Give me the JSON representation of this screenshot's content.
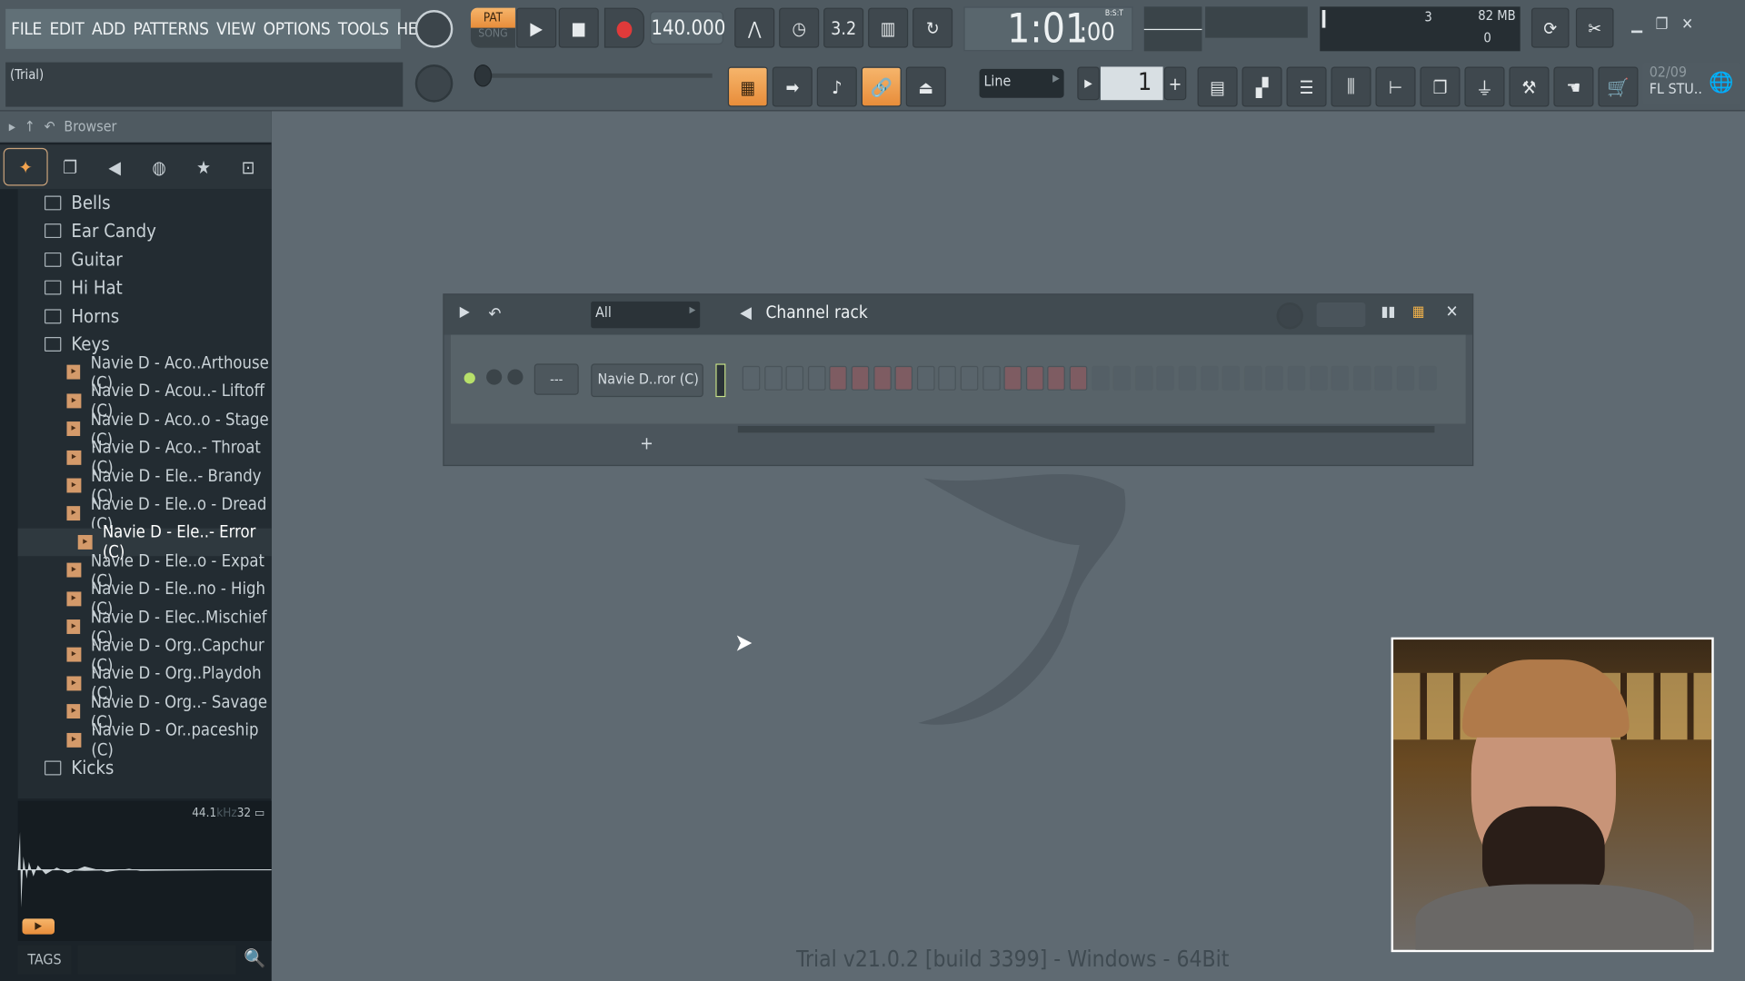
{
  "menu": [
    "FILE",
    "EDIT",
    "ADD",
    "PATTERNS",
    "VIEW",
    "OPTIONS",
    "TOOLS",
    "HELP"
  ],
  "hint": "(Trial)",
  "transport": {
    "pat": "PAT",
    "song": "SONG",
    "tempo": "140.000",
    "time_main": "1:01",
    "time_ticks": ":00",
    "time_format": "B:S:T"
  },
  "cpu": {
    "value": "3",
    "memory": "82 MB",
    "polyphony": "0"
  },
  "toolbar": {
    "snap": "Line",
    "pattern": "1",
    "news_date": "02/09",
    "news_title": "FL STU.."
  },
  "browser": {
    "title": "Browser",
    "items": [
      {
        "type": "folder",
        "label": "Bells"
      },
      {
        "type": "folder",
        "label": "Ear Candy"
      },
      {
        "type": "folder",
        "label": "Guitar"
      },
      {
        "type": "folder",
        "label": "Hi Hat"
      },
      {
        "type": "folder",
        "label": "Horns"
      },
      {
        "type": "folder",
        "label": "Keys",
        "open": true
      },
      {
        "type": "file",
        "label": "Navie D - Aco..Arthouse (C)"
      },
      {
        "type": "file",
        "label": "Navie D - Acou..- Liftoff (C)"
      },
      {
        "type": "file",
        "label": "Navie D - Aco..o - Stage (C)"
      },
      {
        "type": "file",
        "label": "Navie D - Aco..- Throat (C)"
      },
      {
        "type": "file",
        "label": "Navie D - Ele..- Brandy (C)"
      },
      {
        "type": "file",
        "label": "Navie D - Ele..o - Dread (C)"
      },
      {
        "type": "file",
        "label": "Navie D - Ele..- Error (C)",
        "selected": true
      },
      {
        "type": "file",
        "label": "Navie D - Ele..o - Expat (C)"
      },
      {
        "type": "file",
        "label": "Navie D - Ele..no - High (C)"
      },
      {
        "type": "file",
        "label": "Navie D - Elec..Mischief (C)"
      },
      {
        "type": "file",
        "label": "Navie D - Org..Capchur (C)"
      },
      {
        "type": "file",
        "label": "Navie D - Org..Playdoh (C)"
      },
      {
        "type": "file",
        "label": "Navie D - Org..- Savage (C)"
      },
      {
        "type": "file",
        "label": "Navie D - Or..paceship (C)"
      },
      {
        "type": "folder",
        "label": "Kicks"
      }
    ],
    "sample_rate": "44.1",
    "sample_unit": "kHz",
    "bit_depth": "32",
    "tags_label": "TAGS"
  },
  "channel_rack": {
    "title": "Channel rack",
    "filter": "All",
    "channel_name": "Navie D..ror (C)",
    "channel_route": "---",
    "add_label": "+"
  },
  "status": "Trial v21.0.2 [build 3399] - Windows - 64Bit",
  "colors": {
    "accent": "#f0a050",
    "bg": "#5f6a72"
  }
}
